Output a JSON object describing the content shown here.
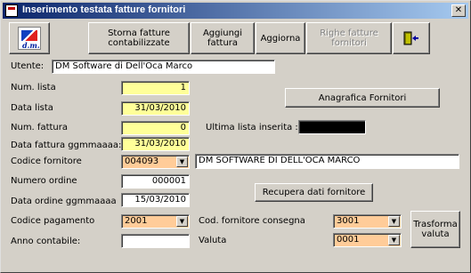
{
  "window": {
    "title": "Inserimento testata fatture fornitori",
    "close_glyph": "✕"
  },
  "toolbar": {
    "logo_text": "d.m.",
    "storna_label": "Storna fatture contabilizzate",
    "aggiungi_label": "Aggiungi fattura",
    "aggiorna_label": "Aggiorna",
    "righe_label": "Righe fatture fornitori",
    "exit_icon": "exit-door-icon"
  },
  "form": {
    "utente_label": "Utente:",
    "utente_value": "DM Software di Dell'Oca Marco",
    "num_lista_label": "Num. lista",
    "num_lista_value": "1",
    "data_lista_label": "Data lista",
    "data_lista_value": "31/03/2010",
    "num_fattura_label": "Num. fattura",
    "num_fattura_value": "0",
    "data_fattura_label": "Data fattura ggmmaaaa:",
    "data_fattura_value": "31/03/2010",
    "codice_fornitore_label": "Codice fornitore",
    "codice_fornitore_value": "004093",
    "fornitore_nome_value": "DM SOFTWARE DI DELL'OCA MARCO",
    "numero_ordine_label": "Numero ordine",
    "numero_ordine_value": "000001",
    "data_ordine_label": "Data ordine ggmmaaaa",
    "data_ordine_value": "15/03/2010",
    "codice_pagamento_label": "Codice pagamento",
    "codice_pagamento_value": "2001",
    "anno_contabile_label": "Anno contabile:",
    "anno_contabile_value": "",
    "anagrafica_label": "Anagrafica Fornitori",
    "ultima_lista_label": "Ultima lista inserita :",
    "recupera_label": "Recupera dati fornitore",
    "cod_fornitore_consegna_label": "Cod. fornitore consegna",
    "cod_fornitore_consegna_value": "3001",
    "valuta_label": "Valuta",
    "valuta_value": "0001",
    "trasforma_label": "Trasforma valuta"
  },
  "colors": {
    "yellow_field": "#ffff99",
    "orange_field": "#ffcc99",
    "titlebar": "#0a246a"
  }
}
